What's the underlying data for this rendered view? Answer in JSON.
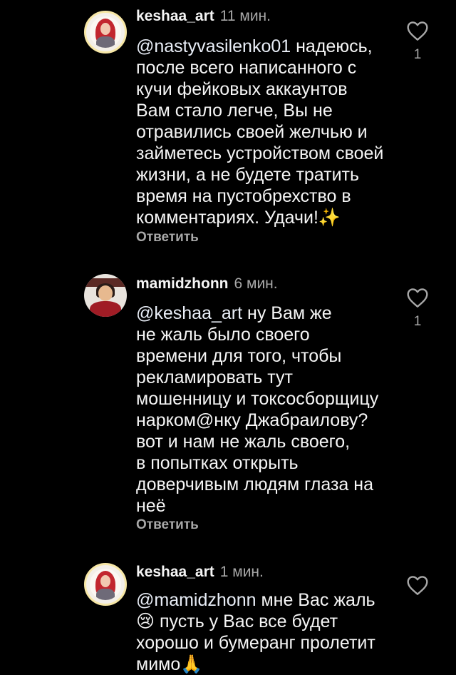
{
  "comments": [
    {
      "username": "keshaa_art",
      "time": "11 мин.",
      "mention": "@nastyvasilenko01",
      "text": " надеюсь,\nпосле всего написанного с\nкучи фейковых аккаунтов\nВам стало легче, Вы не\nотравились своей желчью и\nзайметесь устройством своей\nжизни, а не будете тратить\nвремя на пустобрехство в\nкомментариях. Удачи!✨",
      "reply_label": "Ответить",
      "likes": "1",
      "avatar_icon": "user-avatar-icon",
      "heart_icon": "heart-outline-icon"
    },
    {
      "username": "mamidzhonn",
      "time": "6 мин.",
      "mention": "@keshaa_art",
      "text": " ну Вам же\nне жаль было своего\nвремени для того, чтобы\nрекламировать тут\nмошенницу и токсосборщицу\nнарком@нку Джабраилову?\nвот и нам не жаль своего,\nв попытках открыть\nдоверчивым людям глаза на\nнеё",
      "reply_label": "Ответить",
      "likes": "1",
      "avatar_icon": "user-avatar-icon",
      "heart_icon": "heart-outline-icon"
    },
    {
      "username": "keshaa_art",
      "time": "1 мин.",
      "mention": "@mamidzhonn",
      "text": " мне Вас жаль\n😢 пусть у Вас все будет\nхорошо и бумеранг пролетит\nмимо🙏",
      "reply_label": "",
      "likes": "",
      "avatar_icon": "user-avatar-icon",
      "heart_icon": "heart-outline-icon"
    }
  ],
  "colors": {
    "background": "#000000",
    "text_primary": "#f5f5f5",
    "text_secondary": "#a8a8a8",
    "story_ring": "#f7e7a6"
  }
}
